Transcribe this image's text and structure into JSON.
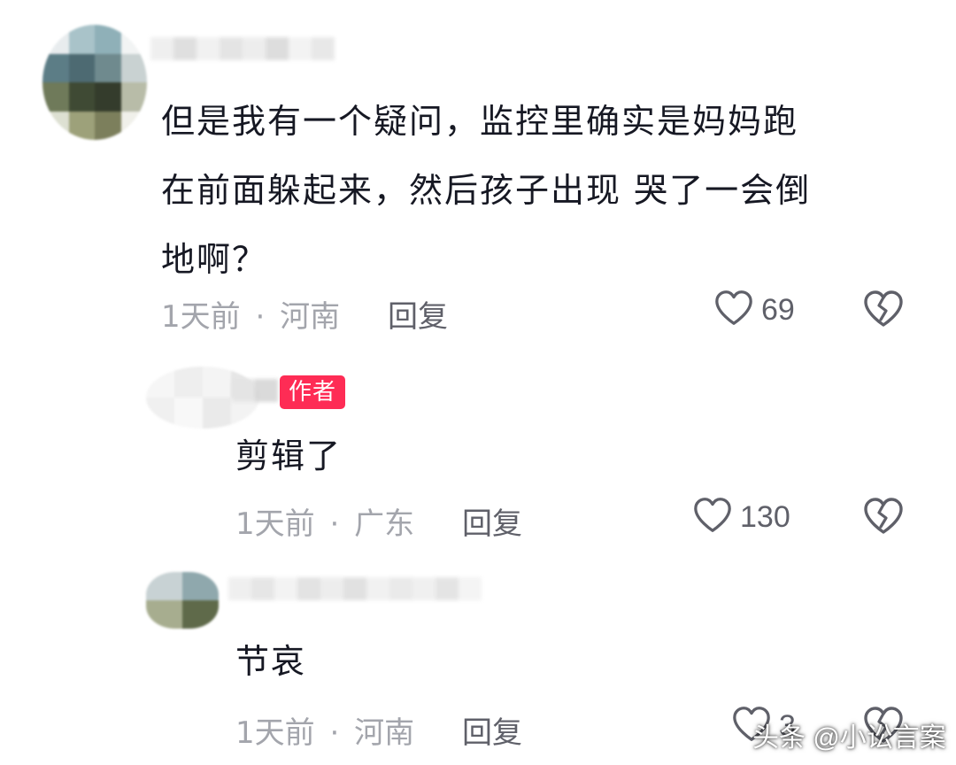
{
  "comments": [
    {
      "text_lines": [
        "但是我有一个疑问，监控里确实是妈妈跑",
        "在前面躲起来，然后孩子出现 哭了一会倒",
        "地啊？"
      ],
      "time": "1天前",
      "separator": "·",
      "location": "河南",
      "reply_label": "回复",
      "likes": "69"
    },
    {
      "badge": "作者",
      "text_lines": [
        "剪辑了"
      ],
      "time": "1天前",
      "separator": "·",
      "location": "广东",
      "reply_label": "回复",
      "likes": "130"
    },
    {
      "text_lines": [
        "节哀"
      ],
      "time": "1天前",
      "separator": "·",
      "location": "河南",
      "reply_label": "回复",
      "likes": "3"
    }
  ],
  "icons": {
    "like": "heart-outline-icon",
    "dislike": "broken-heart-icon"
  },
  "watermark": "头条 @小讼言案",
  "colors": {
    "text": "#161823",
    "meta": "#a3a5ac",
    "action": "#5f6069",
    "badge": "#fe2c55"
  }
}
